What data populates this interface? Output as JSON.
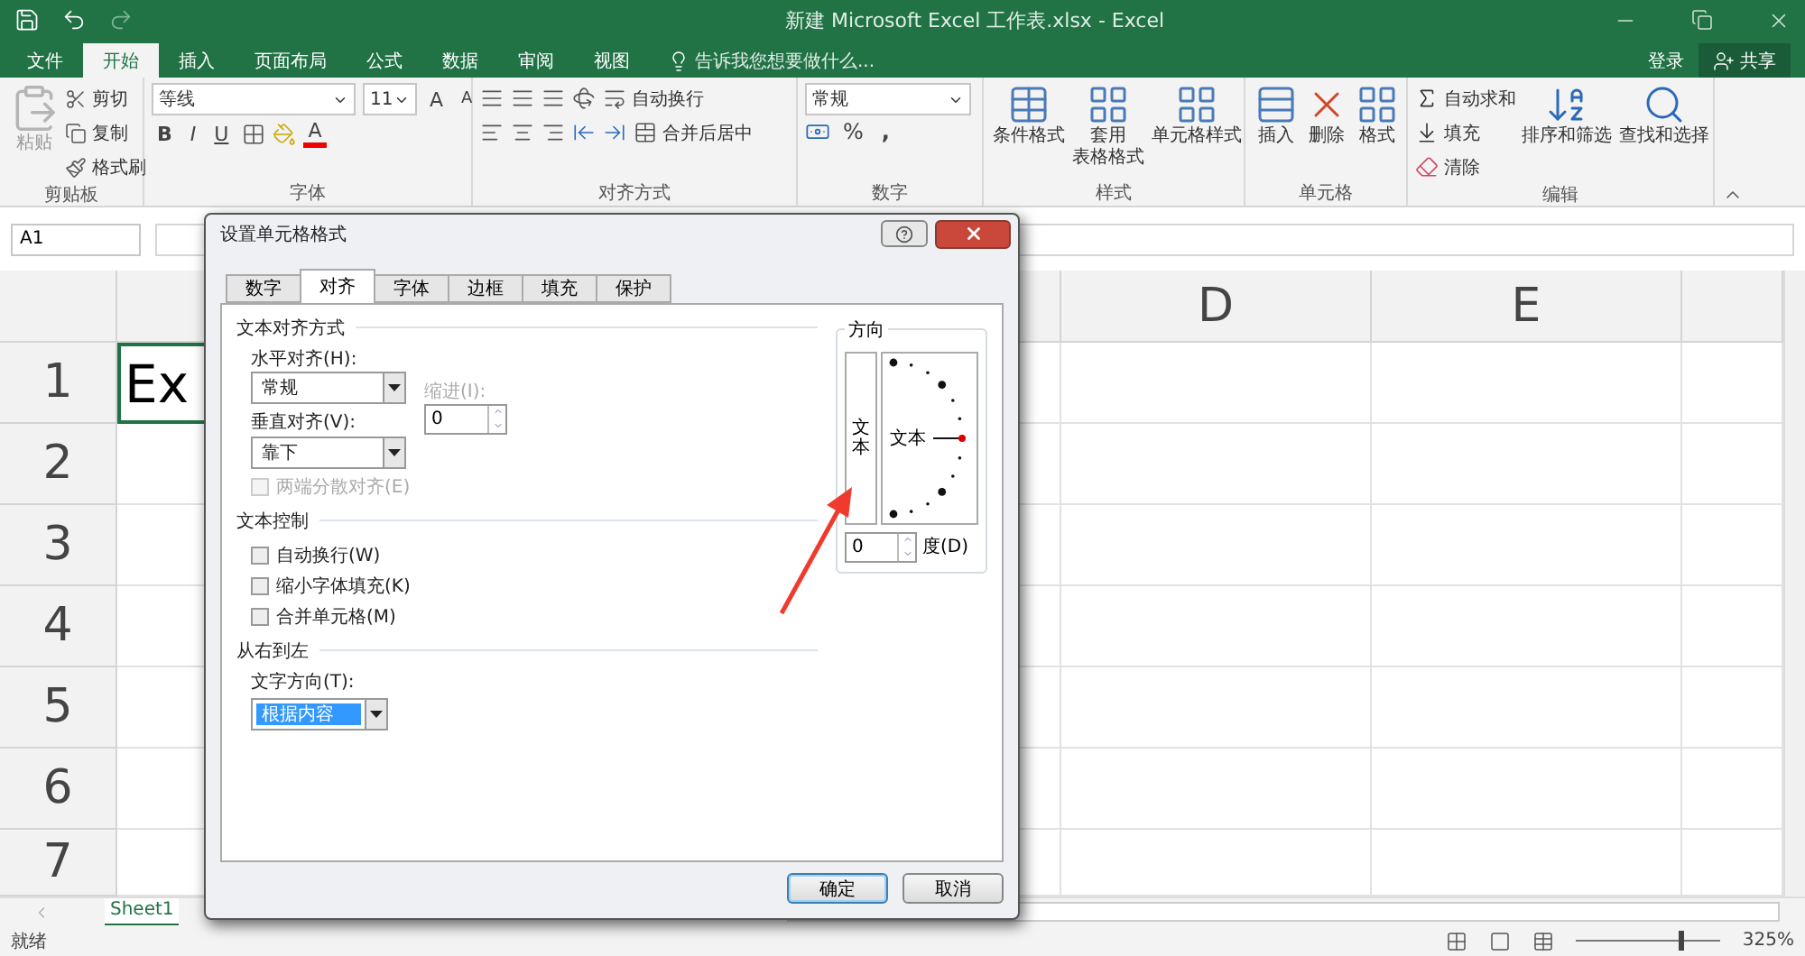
{
  "window": {
    "title": "新建 Microsoft Excel 工作表.xlsx - Excel"
  },
  "ribbon_tabs": [
    {
      "label": "文件",
      "selected": false
    },
    {
      "label": "开始",
      "selected": true
    },
    {
      "label": "插入",
      "selected": false
    },
    {
      "label": "页面布局",
      "selected": false
    },
    {
      "label": "公式",
      "selected": false
    },
    {
      "label": "数据",
      "selected": false
    },
    {
      "label": "审阅",
      "selected": false
    },
    {
      "label": "视图",
      "selected": false
    }
  ],
  "tell_me": {
    "placeholder": "告诉我您想要做什么..."
  },
  "account": {
    "sign_in": "登录",
    "share": "共享"
  },
  "clipboard": {
    "label": "剪贴板",
    "paste": {
      "label": "粘贴",
      "disabled": true
    },
    "actions": [
      "剪切",
      "复制",
      "格式刷"
    ]
  },
  "font": {
    "label": "字体",
    "name": "等线",
    "size": "11",
    "grow": "A",
    "shrink": "A",
    "styles": [
      "B",
      "I",
      "U"
    ],
    "color_glyph": "A"
  },
  "alignment": {
    "label": "对齐方式",
    "wrap": "自动换行",
    "merge": "合并后居中"
  },
  "number": {
    "label": "数字",
    "format": "常规",
    "percent": "%",
    "comma": ","
  },
  "styles": {
    "label": "样式",
    "buttons": [
      {
        "lines": [
          "条件格式"
        ]
      },
      {
        "lines": [
          "套用",
          "表格格式"
        ]
      },
      {
        "lines": [
          "单元格样式"
        ]
      }
    ]
  },
  "cells": {
    "label": "单元格",
    "buttons": [
      "插入",
      "删除",
      "格式"
    ]
  },
  "editing": {
    "label": "编辑",
    "actions": [
      "自动求和",
      "填充",
      "清除"
    ],
    "buttons": [
      "排序和筛选",
      "查找和选择"
    ]
  },
  "name_box": {
    "value": "A1"
  },
  "sheet": {
    "column_headers": [
      "D",
      "E"
    ],
    "row_headers": [
      "1",
      "2",
      "3",
      "4",
      "5",
      "6",
      "7"
    ],
    "active_cell": {
      "value": "Ex",
      "selected": true
    }
  },
  "sheet_tabs": [
    {
      "label": "Sheet1",
      "selected": true
    }
  ],
  "status_bar": {
    "status": "就绪",
    "zoom": "325%",
    "zoom_slider": {
      "level": 0.71
    }
  },
  "dialog": {
    "title": "设置单元格格式",
    "tabs": [
      {
        "label": "数字",
        "selected": false
      },
      {
        "label": "对齐",
        "selected": true
      },
      {
        "label": "字体",
        "selected": false
      },
      {
        "label": "边框",
        "selected": false
      },
      {
        "label": "填充",
        "selected": false
      },
      {
        "label": "保护",
        "selected": false
      }
    ],
    "text_alignment": {
      "heading": "文本对齐方式",
      "horizontal": {
        "label": "水平对齐(H):",
        "value": "常规"
      },
      "vertical": {
        "label": "垂直对齐(V):",
        "value": "靠下"
      },
      "indent": {
        "label": "缩进(I):",
        "value": "0",
        "disabled": true
      },
      "distributed": {
        "label": "两端分散对齐(E)",
        "checked": false,
        "disabled": true
      }
    },
    "text_control": {
      "heading": "文本控制",
      "options": [
        {
          "label": "自动换行(W)",
          "checked": false
        },
        {
          "label": "缩小字体填充(K)",
          "checked": false
        },
        {
          "label": "合并单元格(M)",
          "checked": false
        }
      ]
    },
    "right_to_left": {
      "heading": "从右到左",
      "direction": {
        "label": "文字方向(T):",
        "value": "根据内容",
        "highlighted": true
      }
    },
    "orientation": {
      "heading": "方向",
      "vertical_text": "文本",
      "dial_text": "文本",
      "degrees": "0",
      "degrees_label": "度(D)"
    },
    "buttons": [
      {
        "label": "确定",
        "default": true
      },
      {
        "label": "取消",
        "default": false
      }
    ]
  }
}
